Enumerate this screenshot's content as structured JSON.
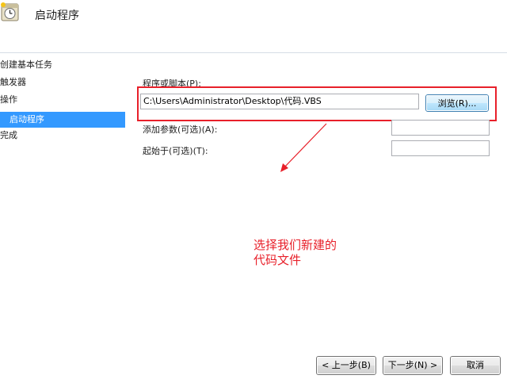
{
  "window": {
    "title": "启动程序"
  },
  "sidebar": {
    "steps": [
      {
        "label": "创建基本任务"
      },
      {
        "label": "触发器"
      },
      {
        "label": "操作"
      },
      {
        "label": "启动程序"
      },
      {
        "label": "完成"
      }
    ]
  },
  "form": {
    "program_label": "程序或脚本(P):",
    "program_value": "C:\\Users\\Administrator\\Desktop\\代码.VBS",
    "browse_label": "浏览(R)...",
    "args_label": "添加参数(可选)(A):",
    "args_value": "",
    "startin_label": "起始于(可选)(T):",
    "startin_value": ""
  },
  "annotation": {
    "line1": "选择我们新建的",
    "line2": "代码文件"
  },
  "footer": {
    "back_label": "< 上一步(B)",
    "next_label": "下一步(N) >",
    "cancel_label": "取消"
  },
  "colors": {
    "selected_step": "#3399ff",
    "annotation_red": "#e8202a"
  },
  "icons": {
    "wizard": "clock-task-icon"
  }
}
